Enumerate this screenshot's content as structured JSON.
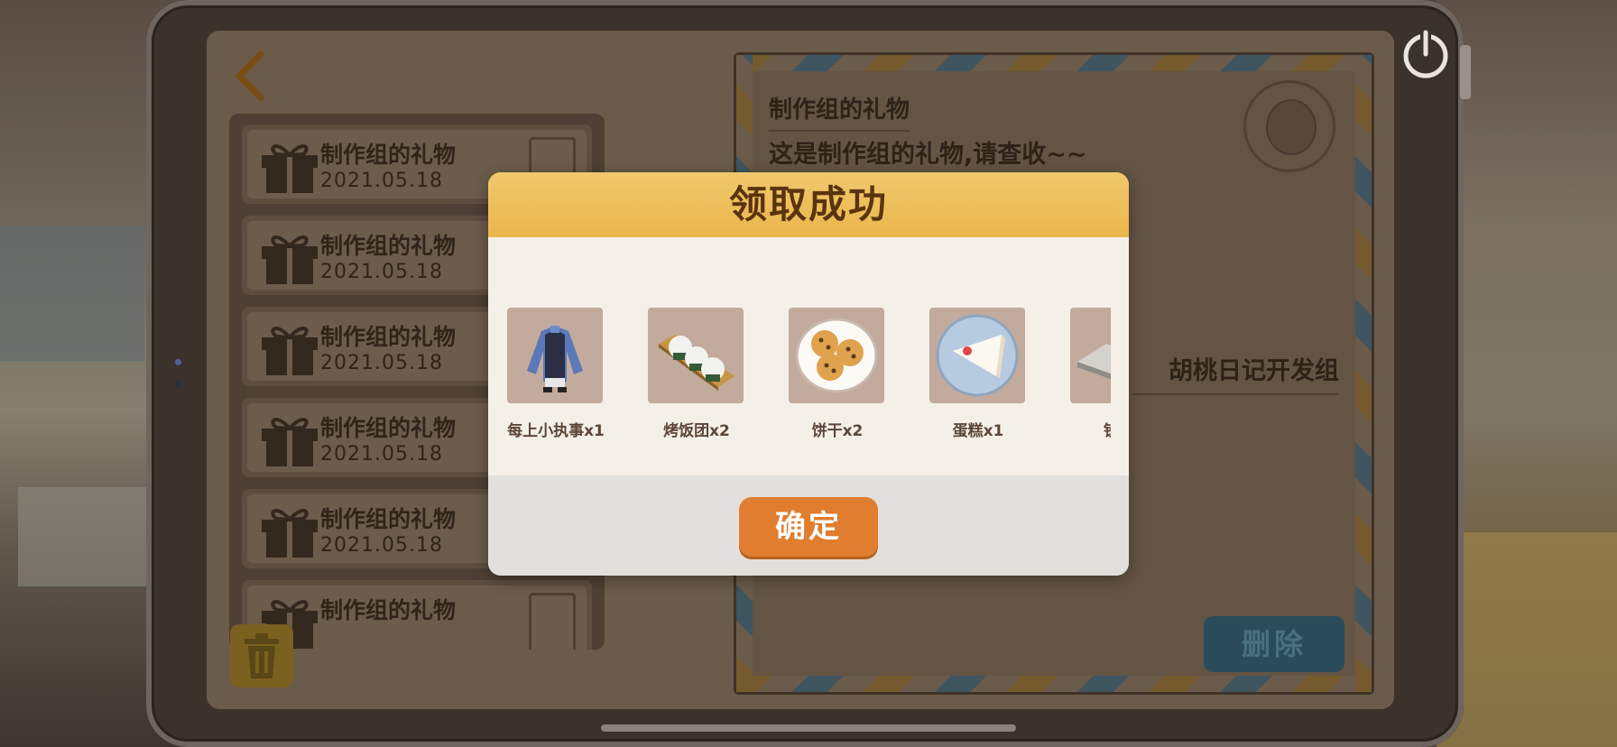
{
  "mail_list": {
    "items": [
      {
        "title": "制作组的礼物",
        "date": "2021.05.18"
      },
      {
        "title": "制作组的礼物",
        "date": "2021.05.18"
      },
      {
        "title": "制作组的礼物",
        "date": "2021.05.18"
      },
      {
        "title": "制作组的礼物",
        "date": "2021.05.18"
      },
      {
        "title": "制作组的礼物",
        "date": "2021.05.18"
      },
      {
        "title": "制作组的礼物",
        "date": ""
      }
    ]
  },
  "letter": {
    "title": "制作组的礼物",
    "body": "这是制作组的礼物,请查收~~",
    "signature": "胡桃日记开发组",
    "delete_label": "删除"
  },
  "modal": {
    "title": "领取成功",
    "confirm_label": "确定",
    "rewards": [
      {
        "label": "每上小执事x1",
        "icon": "butler-outfit-icon"
      },
      {
        "label": "烤饭团x2",
        "icon": "rice-ball-icon"
      },
      {
        "label": "饼干x2",
        "icon": "cookie-icon"
      },
      {
        "label": "蛋糕x1",
        "icon": "cake-icon"
      },
      {
        "label": "钞票",
        "icon": "banknote-icon"
      }
    ]
  },
  "icons": {
    "back": "back-arrow-icon",
    "power": "power-icon",
    "trash": "trash-icon",
    "gift": "gift-icon"
  },
  "colors": {
    "modal_header": "#eab64c",
    "confirm_button": "#e07d2e",
    "title_text": "#5a3410"
  }
}
